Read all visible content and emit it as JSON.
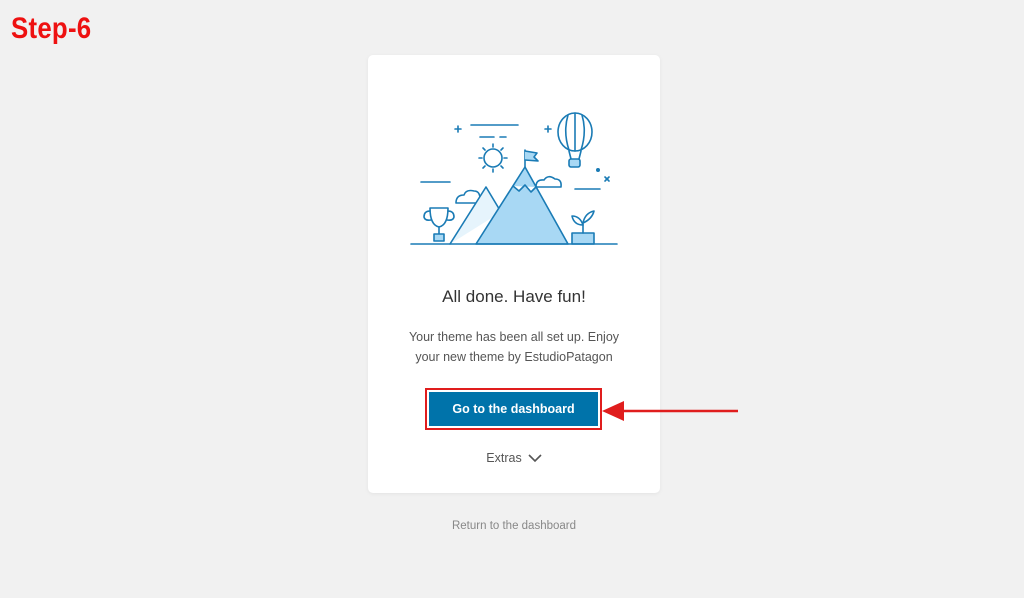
{
  "annotation": {
    "step_label": "Step-6",
    "highlight_color": "#e01d1d"
  },
  "card": {
    "title": "All done. Have fun!",
    "description": "Your theme has been all set up. Enjoy your new theme by EstudioPatagon",
    "primary_button_label": "Go to the dashboard",
    "extras_label": "Extras"
  },
  "footer": {
    "return_link": "Return to the dashboard"
  },
  "colors": {
    "accent": "#0073aa",
    "background": "#f1f1f1",
    "illustration_stroke": "#1a7bb5",
    "illustration_fill": "#a8d8f4"
  }
}
